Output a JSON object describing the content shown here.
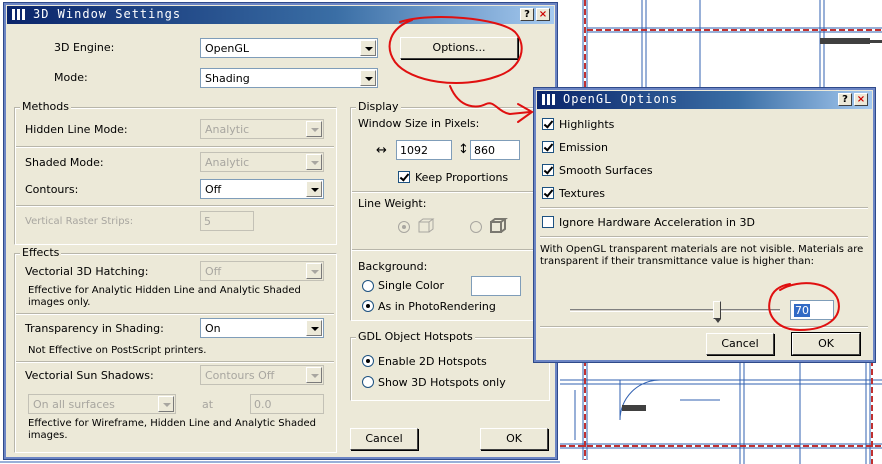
{
  "main_dialog": {
    "title": "3D Window Settings",
    "help_glyph": "?",
    "close_glyph": "×",
    "engine_label": "3D Engine:",
    "engine_value": "OpenGL",
    "options_button": "Options...",
    "mode_label": "Mode:",
    "mode_value": "Shading",
    "methods": {
      "title": "Methods",
      "hidden_line_label": "Hidden Line Mode:",
      "hidden_line_value": "Analytic",
      "shaded_label": "Shaded Mode:",
      "shaded_value": "Analytic",
      "contours_label": "Contours:",
      "contours_value": "Off",
      "raster_label": "Vertical Raster Strips:",
      "raster_value": "5"
    },
    "effects": {
      "title": "Effects",
      "hatching_label": "Vectorial 3D Hatching:",
      "hatching_value": "Off",
      "hatching_note": "Effective for Analytic Hidden Line and Analytic Shaded images only.",
      "transparency_label": "Transparency in Shading:",
      "transparency_value": "On",
      "transparency_note": "Not Effective on PostScript printers.",
      "sun_label": "Vectorial Sun Shadows:",
      "sun_value": "Contours Off",
      "surfaces_value": "On all surfaces",
      "at_label": "at",
      "at_value": "0.0",
      "sun_note": "Effective for Wireframe, Hidden Line and Analytic Shaded images."
    },
    "display": {
      "title": "Display",
      "size_label": "Window Size in Pixels:",
      "width_glyph": "↔",
      "width_value": "1092",
      "height_glyph": "↕",
      "height_value": "860",
      "keep_proportions": "Keep Proportions",
      "keep_proportions_checked": true,
      "line_weight_label": "Line Weight:",
      "background_label": "Background:",
      "single_color": "Single Color",
      "as_photorendering": "As in PhotoRendering",
      "background_selected": "As in PhotoRendering"
    },
    "gdl": {
      "title": "GDL Object Hotspots",
      "enable_2d": "Enable 2D Hotspots",
      "show_3d": "Show 3D Hotspots only",
      "selected": "Enable 2D Hotspots"
    },
    "cancel_button": "Cancel",
    "ok_button": "OK"
  },
  "opengl_dialog": {
    "title": "OpenGL Options",
    "help_glyph": "?",
    "close_glyph": "×",
    "options": [
      {
        "label": "Highlights",
        "checked": true
      },
      {
        "label": "Emission",
        "checked": true
      },
      {
        "label": "Smooth Surfaces",
        "checked": true
      },
      {
        "label": "Textures",
        "checked": true
      }
    ],
    "ignore_hw": "Ignore Hardware Acceleration in 3D",
    "ignore_hw_checked": false,
    "info_text": "With OpenGL transparent materials are not visible. Materials are transparent if their transmittance value is higher than:",
    "slider_value_fraction": 0.7,
    "threshold_value": "70",
    "cancel_button": "Cancel",
    "ok_button": "OK"
  },
  "colors": {
    "dialog_bg": "#ece9d8",
    "titlebar_start": "#0a246a",
    "titlebar_end": "#a6caf0",
    "annotation_red": "#e01010",
    "cad_blue": "#3060b0",
    "cad_red": "#c03030"
  }
}
